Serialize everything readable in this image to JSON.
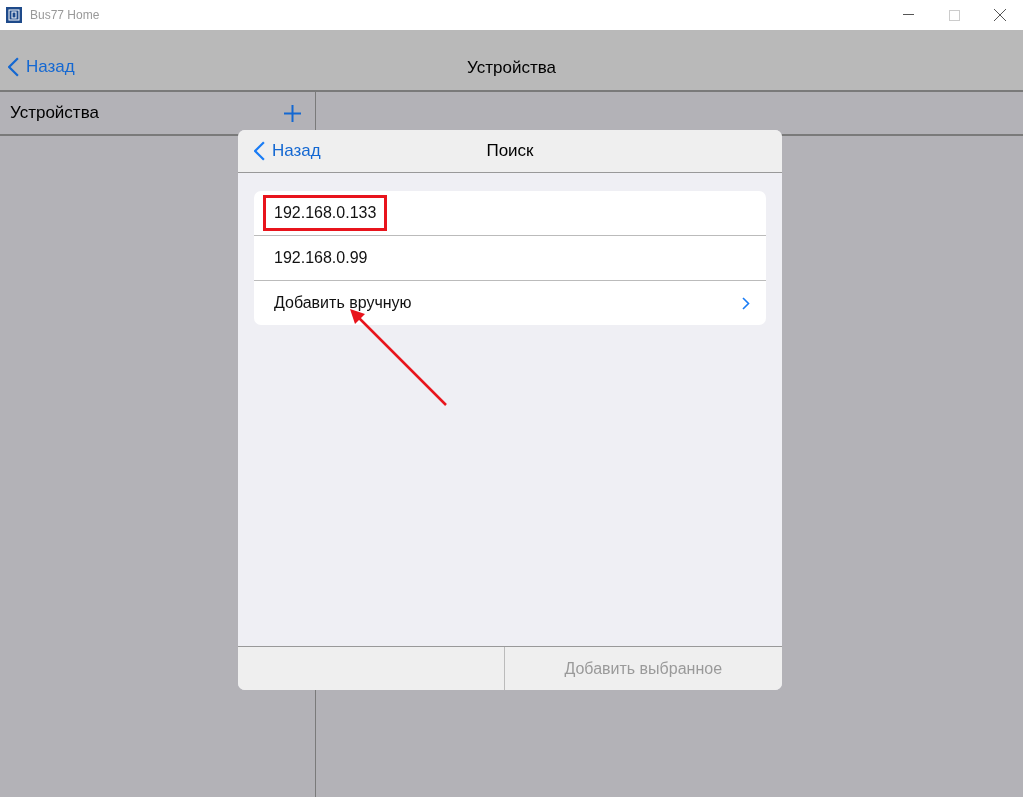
{
  "window": {
    "title": "Bus77 Home"
  },
  "nav_bar": {
    "back": "Назад",
    "title": "Устройства"
  },
  "sidebar": {
    "title": "Устройства"
  },
  "dialog": {
    "back": "Назад",
    "title": "Поиск",
    "items": [
      {
        "kind": "device",
        "label": "192.168.0.133",
        "highlighted": true
      },
      {
        "kind": "device",
        "label": "192.168.0.99",
        "highlighted": false
      },
      {
        "kind": "action",
        "label": "Добавить вручную",
        "highlighted": false
      }
    ],
    "footer": {
      "button": "Добавить выбранное",
      "disabled": true
    }
  }
}
